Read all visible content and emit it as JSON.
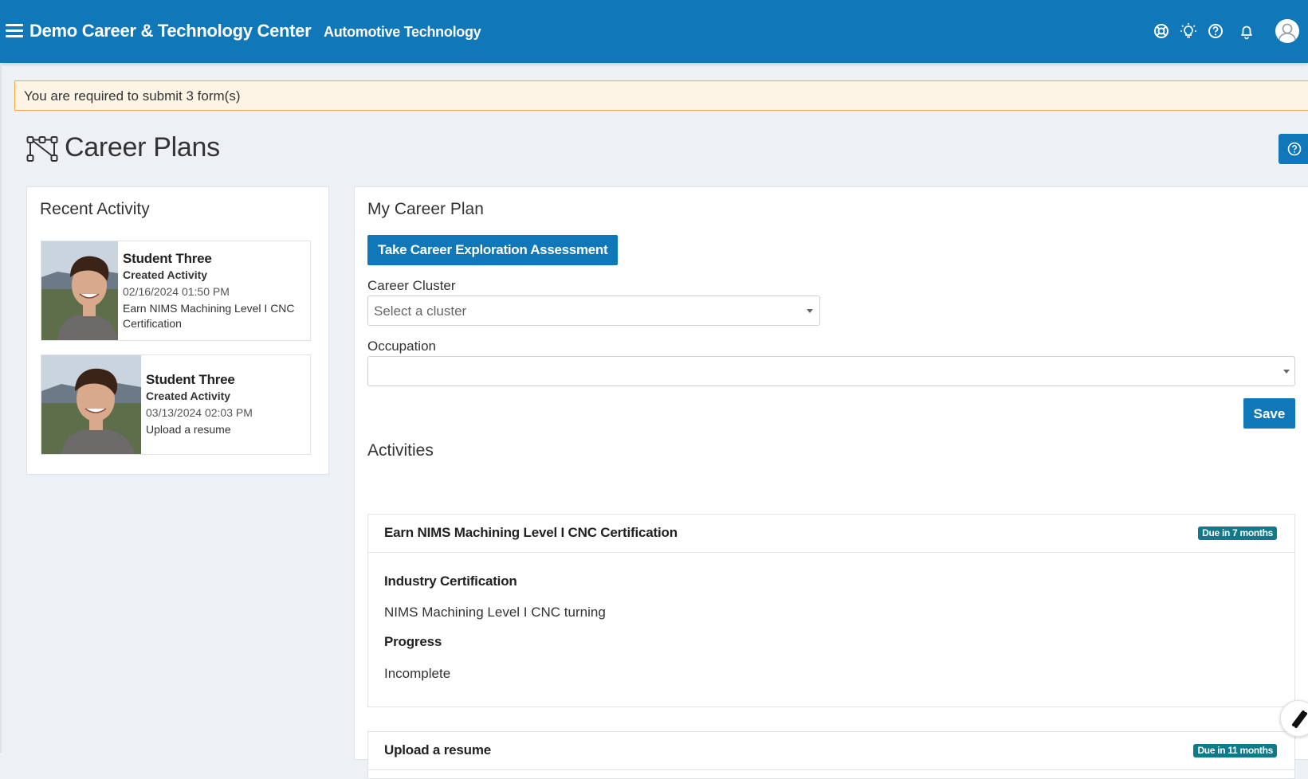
{
  "header": {
    "app_title": "Demo Career & Technology Center",
    "program": "Automotive Technology",
    "icons": [
      "menu-icon",
      "lifebuoy-icon",
      "lightbulb-icon",
      "help-icon",
      "bell-icon",
      "user-avatar-icon"
    ]
  },
  "alert": {
    "text": "You are required to submit 3 form(s)"
  },
  "page": {
    "title": "Career Plans",
    "icon": "career-path-icon"
  },
  "recent_activity": {
    "heading": "Recent Activity",
    "items": [
      {
        "name": "Student Three",
        "action": "Created Activity",
        "date": "02/16/2024 01:50 PM",
        "description": "Earn NIMS Machining Level I CNC Certification"
      },
      {
        "name": "Student Three",
        "action": "Created Activity",
        "date": "03/13/2024 02:03 PM",
        "description": "Upload a resume"
      }
    ]
  },
  "career_plan": {
    "heading": "My Career Plan",
    "assessment_button": "Take Career Exploration Assessment",
    "cluster_label": "Career Cluster",
    "cluster_placeholder": "Select a cluster",
    "occupation_label": "Occupation",
    "occupation_value": "",
    "save_button": "Save"
  },
  "activities": {
    "heading": "Activities",
    "items": [
      {
        "title": "Earn NIMS Machining Level I CNC Certification",
        "badge": "Due in 7 months",
        "type_label": "Industry Certification",
        "type_value": "NIMS Machining Level I CNC turning",
        "progress_label": "Progress",
        "progress_value": "Incomplete"
      },
      {
        "title": "Upload a resume",
        "badge": "Due in 11 months"
      }
    ]
  },
  "colors": {
    "brand": "#1078b8",
    "badge": "#0f7a8c",
    "alert_bg": "#fef4e5",
    "alert_border": "#f1a83e",
    "page_bg": "#edf0f5"
  }
}
